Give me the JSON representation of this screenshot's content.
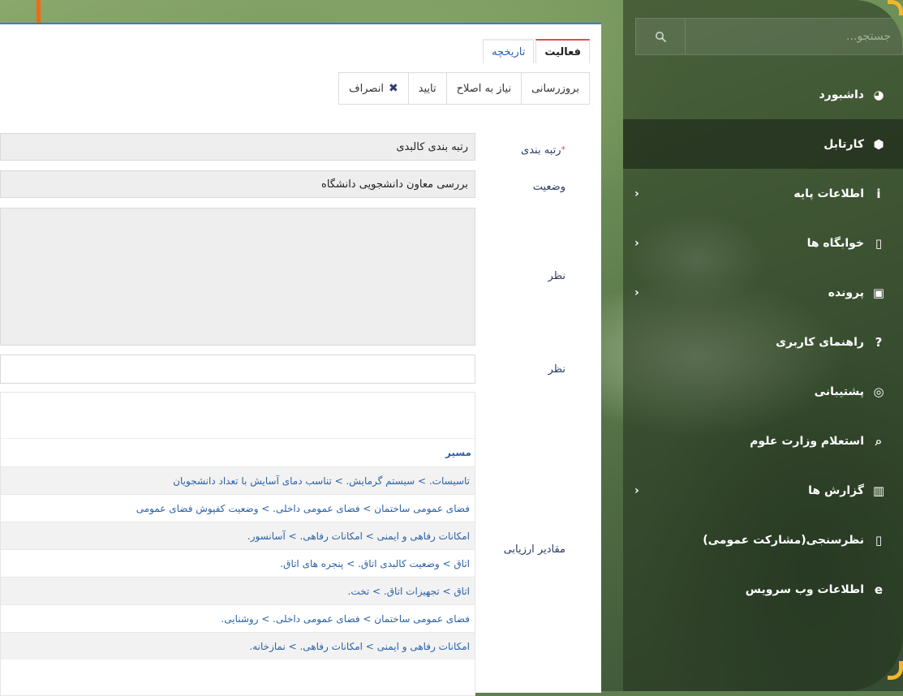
{
  "sidebar": {
    "search": {
      "placeholder": "جستجو..."
    },
    "items": [
      {
        "label": "داشبورد",
        "icon": "dashboard-icon",
        "glyph": "◕",
        "chevron": false,
        "active": false
      },
      {
        "label": "کارتابل",
        "icon": "box-icon",
        "glyph": "⬢",
        "chevron": false,
        "active": true
      },
      {
        "label": "اطلاعات پایه",
        "icon": "info-icon",
        "glyph": "i",
        "chevron": true,
        "active": false
      },
      {
        "label": "خوابگاه ها",
        "icon": "dormitory-icon",
        "glyph": "▯",
        "chevron": true,
        "active": false
      },
      {
        "label": "پرونده",
        "icon": "file-icon",
        "glyph": "▣",
        "chevron": true,
        "active": false
      },
      {
        "label": "راهنمای کاربری",
        "icon": "help-icon",
        "glyph": "?",
        "chevron": false,
        "active": false
      },
      {
        "label": "پشتیبانی",
        "icon": "lifebuoy-icon",
        "glyph": "◎",
        "chevron": false,
        "active": false
      },
      {
        "label": "استعلام وزارت علوم",
        "icon": "search-icon",
        "glyph": "⌕",
        "chevron": false,
        "active": false
      },
      {
        "label": "گزارش ها",
        "icon": "bar-chart-icon",
        "glyph": "▥",
        "chevron": true,
        "active": false
      },
      {
        "label": "نظرسنجی(مشارکت عمومی)",
        "icon": "survey-icon",
        "glyph": "▯",
        "chevron": false,
        "active": false
      },
      {
        "label": "اطلاعات وب سرویس",
        "icon": "browser-icon",
        "glyph": "e",
        "chevron": false,
        "active": false
      }
    ]
  },
  "main": {
    "tabs": {
      "activity": "فعالیت",
      "history": "تاریخچه"
    },
    "toolbar": {
      "update": "بروزرسانی",
      "needs_fix": "نیاز به اصلاح",
      "approve": "تایید",
      "cancel": "انصراف"
    },
    "form": {
      "ranking_label": "رتبه بندی",
      "ranking_value": "رتبه بندی کالبدی",
      "status_label": "وضعیت",
      "status_value": "بررسی معاون دانشجویی دانشگاه",
      "comment_label_1": "نظر",
      "comment_label_2": "نظر",
      "comment_value": "",
      "eval_label": "مقادیر ارزیابی"
    },
    "evaluation": {
      "column_title": "مسیر",
      "rows": [
        "تاسیسات. > سیستم گرمایش. > تناسب دمای آسایش با تعداد دانشجویان",
        "فضای عمومی ساختمان > فضای عمومی داخلی. > وضعیت کفپوش فضای عمومی",
        "امکانات رفاهی و ایمنی > امکانات رفاهی. > آسانسور.",
        "اتاق > وضعیت کالبدی اتاق. > پنجره های اتاق.",
        "اتاق > تجهیزات اتاق. > تخت.",
        "فضای عمومی ساختمان > فضای عمومی داخلی. > روشنایی.",
        "امکانات رفاهی و ایمنی > امکانات رفاهی. > نمازخانه."
      ]
    }
  },
  "colors": {
    "accent_blue": "#3a7bd5",
    "link_blue": "#2c62a8",
    "tab_active_red": "#e64a4a",
    "frame_orange": "#f36a12"
  }
}
